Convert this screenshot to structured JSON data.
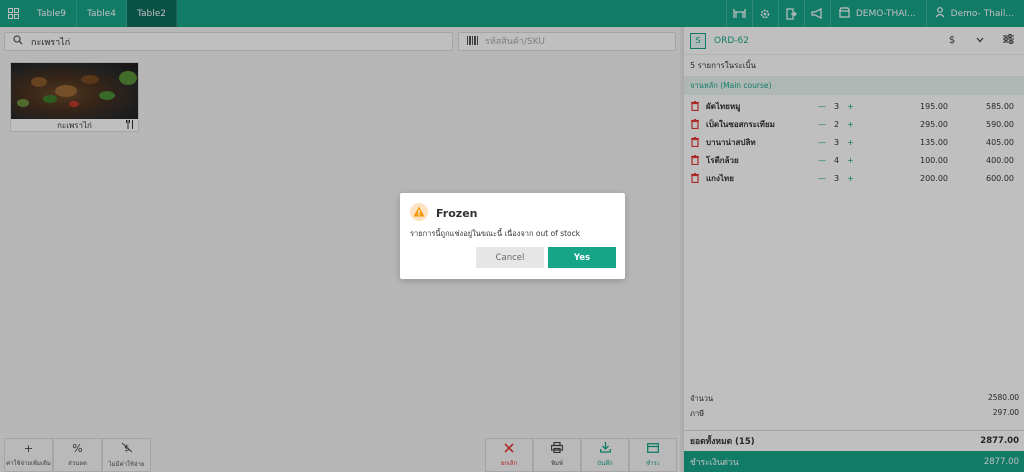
{
  "colors": {
    "accent": "#17a589",
    "accent_dark": "#0d6b5c",
    "danger": "#e53935",
    "warning": "#f39c12"
  },
  "topbar": {
    "tabs": [
      {
        "label": "Table9",
        "active": false
      },
      {
        "label": "Table4",
        "active": false
      },
      {
        "label": "Table2",
        "active": true
      }
    ],
    "icons": [
      "grid-icon",
      "table-icon",
      "gear-icon",
      "exit-icon",
      "megaphone-icon",
      "store-icon",
      "user-icon"
    ],
    "store_label": "DEMO-THAI...",
    "user_label": "Demo- Thail..."
  },
  "search": {
    "value": "กะเพราไก่",
    "placeholder": ""
  },
  "sku": {
    "placeholder": "รหัสสินค้า/SKU"
  },
  "product": {
    "name": "กะเพราไก่"
  },
  "bottom_left": [
    {
      "label": "ค่าใช้จ่ายเพิ่มเติม",
      "icon": "plus-icon"
    },
    {
      "label": "ส่วนลด",
      "icon": "percent-icon"
    },
    {
      "label": "ไม่มีค่าใช้จ่าย",
      "icon": "no-charge-icon"
    }
  ],
  "bottom_right": [
    {
      "label": "ยกเลิก",
      "icon": "x-icon"
    },
    {
      "label": "พิมพ์",
      "icon": "printer-icon"
    },
    {
      "label": "บันทึก",
      "icon": "download-icon"
    },
    {
      "label": "ชำระ",
      "icon": "card-icon"
    }
  ],
  "order": {
    "seat": "S",
    "number": "ORD-62",
    "item_count": "5 รายการในระเบิ้น",
    "category": "จานหลัก (Main course)",
    "items": [
      {
        "name": "ผัดไทยหมู",
        "qty": "3",
        "price": "195.00",
        "total": "585.00"
      },
      {
        "name": "เป็ดในซอสกระเทียม",
        "qty": "2",
        "price": "295.00",
        "total": "590.00"
      },
      {
        "name": "บานาน่าสปลิท",
        "qty": "3",
        "price": "135.00",
        "total": "405.00"
      },
      {
        "name": "โรตีกล้วย",
        "qty": "4",
        "price": "100.00",
        "total": "400.00"
      },
      {
        "name": "แกงไทย",
        "qty": "3",
        "price": "200.00",
        "total": "600.00"
      }
    ],
    "subtotal_label": "จำนวน",
    "subtotal": "2580.00",
    "tax_label": "ภาษี",
    "tax": "297.00",
    "grand_label": "ยอดทั้งหมด  (15)",
    "grand_total": "2877.00",
    "pay_label": "ชำระเงินด่วน",
    "pay_total": "2877.00"
  },
  "modal": {
    "title": "Frozen",
    "message": "รายการนี้ถูกแช่งอยู่ในขณะนี้ เนื่องจาก out of stock",
    "cancel_label": "Cancel",
    "yes_label": "Yes"
  }
}
